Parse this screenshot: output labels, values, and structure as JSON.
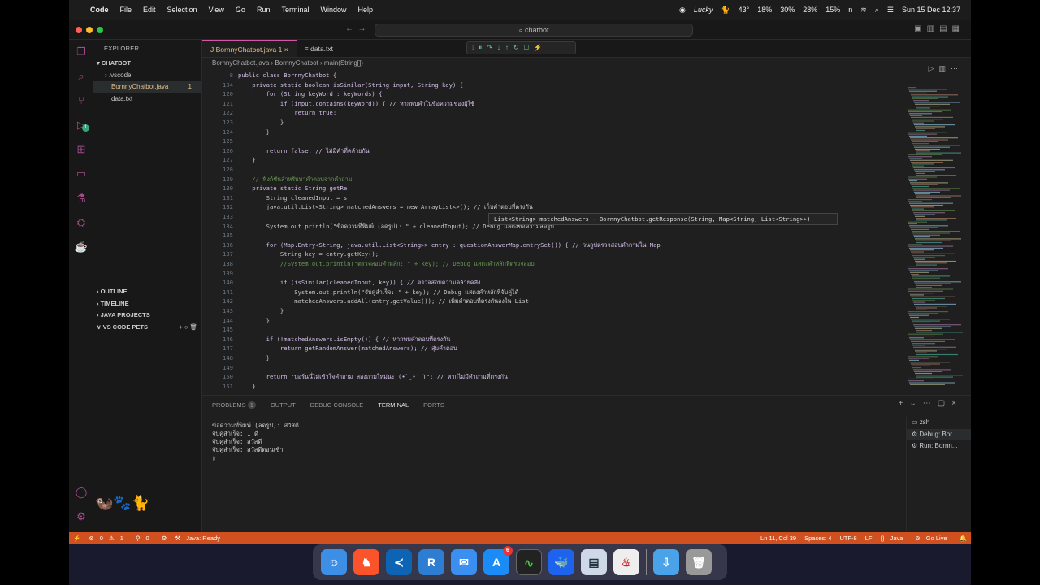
{
  "menubar": {
    "app": "Code",
    "items": [
      "File",
      "Edit",
      "Selection",
      "View",
      "Go",
      "Run",
      "Terminal",
      "Window",
      "Help"
    ],
    "status_items": [
      "Lucky",
      "43°",
      "18%",
      "30%",
      "28%",
      "15%",
      "n"
    ],
    "datetime": "Sun 15 Dec 12:37"
  },
  "window": {
    "command_center": "chatbot"
  },
  "sidebar": {
    "title": "EXPLORER",
    "folder": "CHATBOT",
    "files": [
      {
        "name": ".vscode",
        "badge": ""
      },
      {
        "name": "BornnyChatbot.java",
        "badge": "1"
      },
      {
        "name": "data.txt",
        "badge": ""
      }
    ],
    "sections": [
      "OUTLINE",
      "TIMELINE",
      "JAVA PROJECTS",
      "VS CODE PETS"
    ],
    "activity_badge": "1"
  },
  "editor": {
    "tabs": [
      {
        "label": "BornnyChatbot.java",
        "badge": "1"
      },
      {
        "label": "data.txt",
        "badge": ""
      }
    ],
    "breadcrumb": [
      "BornnyChatbot.java",
      "BornnyChatbot",
      "main(String[])"
    ],
    "hover": "List<String> matchedAnswers - BornnyChatbot.getResponse(String, Map<String, List<String>>)",
    "lines": [
      {
        "n": "8",
        "t": "public class BornnyChatbot {"
      },
      {
        "n": "104",
        "t": "    private static boolean isSimilar(String input, String key) {"
      },
      {
        "n": "120",
        "t": "        for (String keyWord : keyWords) {"
      },
      {
        "n": "121",
        "t": "            if (input.contains(keyWord)) { // หากพบคำในข้อความของผู้ใช้"
      },
      {
        "n": "122",
        "t": "                return true;"
      },
      {
        "n": "123",
        "t": "            }"
      },
      {
        "n": "124",
        "t": "        }"
      },
      {
        "n": "125",
        "t": ""
      },
      {
        "n": "126",
        "t": "        return false; // ไม่มีคำที่คล้ายกัน"
      },
      {
        "n": "127",
        "t": "    }"
      },
      {
        "n": "128",
        "t": ""
      },
      {
        "n": "129",
        "t": "    // ฟังก์ชันสำหรับหาคำตอบจากคำถาม"
      },
      {
        "n": "130",
        "t": "    private static String getRe"
      },
      {
        "n": "131",
        "t": "        String cleanedInput = s"
      },
      {
        "n": "132",
        "t": "        java.util.List<String> matchedAnswers = new ArrayList<>(); // เก็บคำตอบที่ตรงกัน"
      },
      {
        "n": "133",
        "t": ""
      },
      {
        "n": "134",
        "t": "        System.out.println(\"ข้อความที่พิมพ์ (ลดรูป): \" + cleanedInput); // Debug แสดงข้อความลดรูป"
      },
      {
        "n": "135",
        "t": ""
      },
      {
        "n": "136",
        "t": "        for (Map.Entry<String, java.util.List<String>> entry : questionAnswerMap.entrySet()) { // วนลูปตรวจสอบคำถามใน Map"
      },
      {
        "n": "137",
        "t": "            String key = entry.getKey();"
      },
      {
        "n": "138",
        "t": "            //System.out.println(\"ตรวจสอบคำหลัก: \" + key); // Debug แสดงคำหลักที่ตรวจสอบ"
      },
      {
        "n": "139",
        "t": ""
      },
      {
        "n": "140",
        "t": "            if (isSimilar(cleanedInput, key)) { // ตรวจสอบความคล้ายคลึง"
      },
      {
        "n": "141",
        "t": "                System.out.println(\"จับคู่สำเร็จ: \" + key); // Debug แสดงคำหลักที่จับคู่ได้"
      },
      {
        "n": "142",
        "t": "                matchedAnswers.addAll(entry.getValue()); // เพิ่มคำตอบที่ตรงกันลงใน List"
      },
      {
        "n": "143",
        "t": "            }"
      },
      {
        "n": "144",
        "t": "        }"
      },
      {
        "n": "145",
        "t": ""
      },
      {
        "n": "146",
        "t": "        if (!matchedAnswers.isEmpty()) { // หากพบคำตอบที่ตรงกัน"
      },
      {
        "n": "147",
        "t": "            return getRandomAnswer(matchedAnswers); // สุ่มคำตอบ"
      },
      {
        "n": "148",
        "t": "        }"
      },
      {
        "n": "149",
        "t": ""
      },
      {
        "n": "150",
        "t": "        return \"บอร์นนี่ไม่เข้าใจคำถาม ลองถามใหม่นะ (•`‿•´ )\"; // หากไม่มีคำถามที่ตรงกัน"
      },
      {
        "n": "151",
        "t": "    }"
      }
    ]
  },
  "panel": {
    "tabs": [
      {
        "label": "PROBLEMS",
        "badge": "1"
      },
      {
        "label": "OUTPUT",
        "badge": ""
      },
      {
        "label": "DEBUG CONSOLE",
        "badge": ""
      },
      {
        "label": "TERMINAL",
        "badge": ""
      },
      {
        "label": "PORTS",
        "badge": ""
      }
    ],
    "terminal_lines": [
      "ข้อความที่พิมพ์ (ลดรูป): สวัสดี",
      "จับคู่สำเร็จ: 1 ดี",
      "จับคู่สำเร็จ: สวัสดี",
      "จับคู่สำเร็จ: สวัสดีตอนเช้า"
    ],
    "terminals": [
      "zsh",
      "Debug: Bor...",
      "Run: Bornn..."
    ]
  },
  "statusbar": {
    "errors": "0",
    "warnings": "1",
    "ports": "0",
    "java": "Java: Ready",
    "position": "Ln 11, Col 39",
    "spaces": "Spaces: 4",
    "encoding": "UTF-8",
    "eol": "LF",
    "language": "Java",
    "golive": "Go Live"
  },
  "dock": {
    "apps": [
      "Finder",
      "Brave",
      "VS Code",
      "Remote Desktop",
      "Mail",
      "App Store",
      "Activity Monitor",
      "Docker",
      "Preview",
      "Java",
      "Downloads",
      "Trash"
    ],
    "app_store_badge": "6"
  },
  "colors": {
    "accent": "#d058a8",
    "statusbar": "#d0501f",
    "activity": "#a34c8c"
  }
}
